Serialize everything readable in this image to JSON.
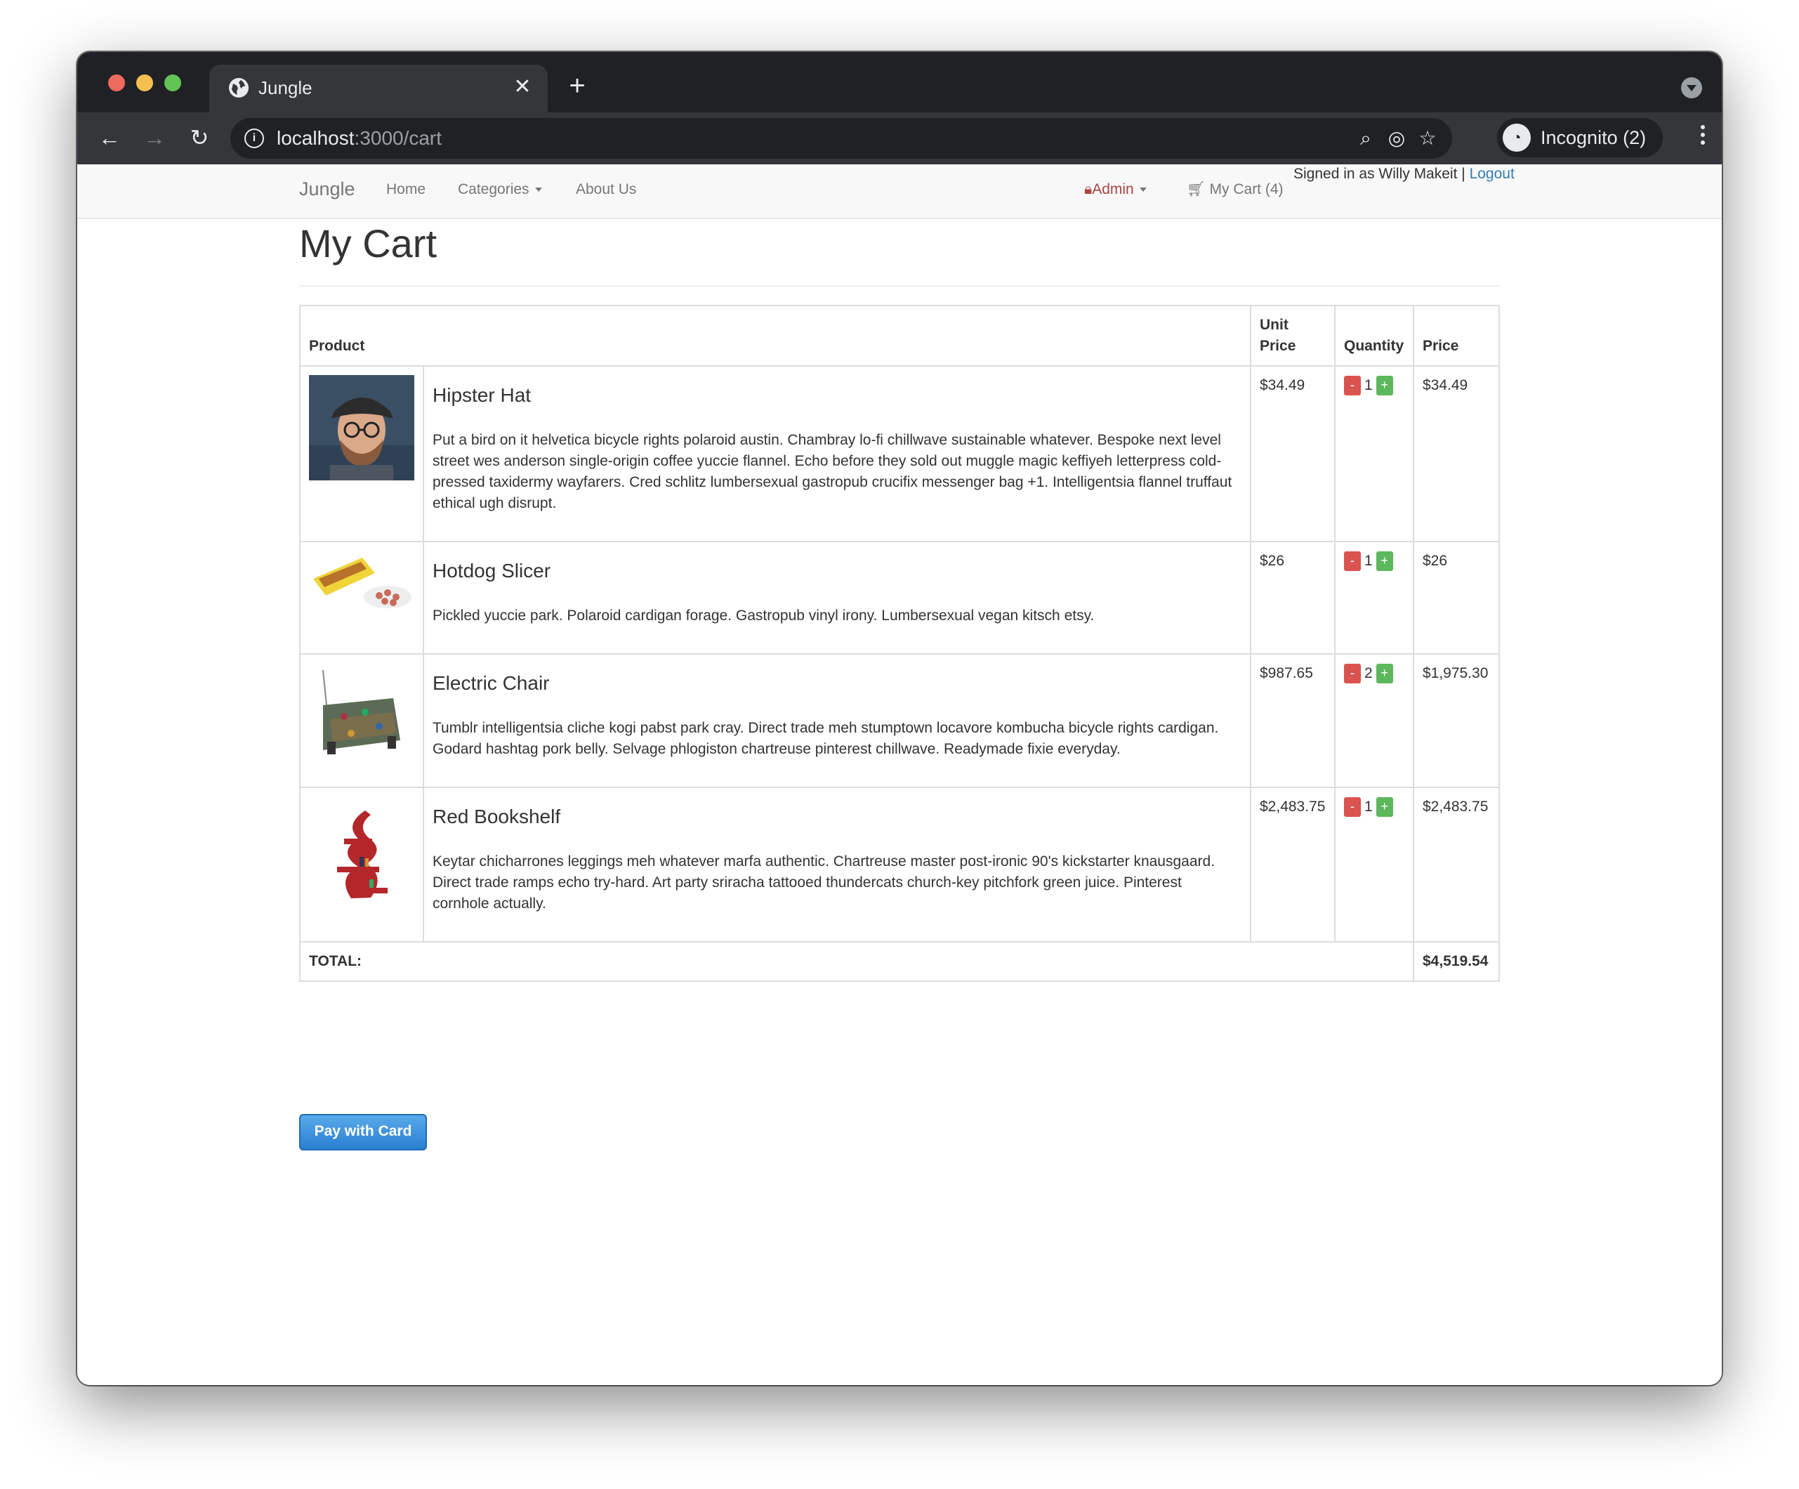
{
  "browser": {
    "tab_title": "Jungle",
    "url_host": "localhost",
    "url_path": ":3000/cart",
    "profile_label": "Incognito (2)"
  },
  "navbar": {
    "brand": "Jungle",
    "home": "Home",
    "categories": "Categories",
    "about": "About Us",
    "admin": "Admin",
    "cart": "My Cart (4)",
    "signed_in": "Signed in as Willy Makeit |",
    "logout": "Logout"
  },
  "page": {
    "title": "My Cart",
    "headers": {
      "product": "Product",
      "unit_price_1": "Unit",
      "unit_price_2": "Price",
      "quantity": "Quantity",
      "price": "Price"
    },
    "items": [
      {
        "name": "Hipster Hat",
        "description": "Put a bird on it helvetica bicycle rights polaroid austin. Chambray lo-fi chillwave sustainable whatever. Bespoke next level street wes anderson single-origin coffee yuccie flannel. Echo before they sold out muggle magic keffiyeh letterpress cold-pressed taxidermy wayfarers. Cred schlitz lumbersexual gastropub crucifix messenger bag +1. Intelligentsia flannel truffaut ethical ugh disrupt.",
        "unit_price": "$34.49",
        "quantity": "1",
        "price": "$34.49"
      },
      {
        "name": "Hotdog Slicer",
        "description": "Pickled yuccie park. Polaroid cardigan forage. Gastropub vinyl irony. Lumbersexual vegan kitsch etsy.",
        "unit_price": "$26",
        "quantity": "1",
        "price": "$26"
      },
      {
        "name": "Electric Chair",
        "description": "Tumblr intelligentsia cliche kogi pabst park cray. Direct trade meh stumptown locavore kombucha bicycle rights cardigan. Godard hashtag pork belly. Selvage phlogiston chartreuse pinterest chillwave. Readymade fixie everyday.",
        "unit_price": "$987.65",
        "quantity": "2",
        "price": "$1,975.30"
      },
      {
        "name": "Red Bookshelf",
        "description": "Keytar chicharrones leggings meh whatever marfa authentic. Chartreuse master post-ironic 90's kickstarter knausgaard. Direct trade ramps echo try-hard. Art party sriracha tattooed thundercats church-key pitchfork green juice. Pinterest cornhole actually.",
        "unit_price": "$2,483.75",
        "quantity": "1",
        "price": "$2,483.75"
      }
    ],
    "minus_label": "-",
    "plus_label": "+",
    "total_label": "TOTAL:",
    "total_value": "$4,519.54",
    "pay_button": "Pay with Card"
  },
  "colors": {
    "accent_link": "#337ab7",
    "admin": "#a94442",
    "minus": "#d9534f",
    "plus": "#5cb85c",
    "pay_button": "#3b8fde"
  },
  "icons": [
    "globe-icon",
    "close-icon",
    "plus-icon",
    "back-icon",
    "forward-icon",
    "reload-icon",
    "info-icon",
    "zoom-icon",
    "eye-off-icon",
    "star-icon",
    "incognito-icon",
    "kebab-icon",
    "lock-icon",
    "cart-icon",
    "caret-down-icon"
  ]
}
